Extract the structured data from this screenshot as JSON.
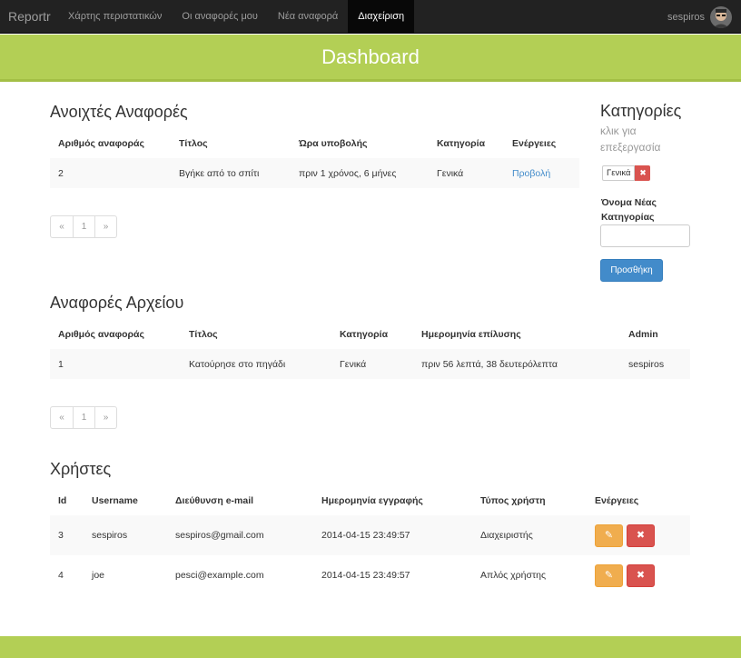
{
  "navbar": {
    "brand": "Reportr",
    "items": [
      {
        "label": "Χάρτης περιστατικών"
      },
      {
        "label": "Οι αναφορές μου"
      },
      {
        "label": "Νέα αναφορά"
      },
      {
        "label": "Διαχείριση"
      }
    ],
    "active_index": 3,
    "username": "sespiros"
  },
  "banner": {
    "title": "Dashboard"
  },
  "open_reports": {
    "heading": "Ανοιχτές Αναφορές",
    "columns": [
      "Αριθμός αναφοράς",
      "Τίτλος",
      "Ώρα υποβολής",
      "Κατηγορία",
      "Ενέργειες"
    ],
    "rows": [
      {
        "id": "2",
        "title": "Βγήκε από το σπίτι",
        "submitted": "πριν 1 χρόνος, 6 μήνες",
        "category": "Γενικά",
        "action": "Προβολή"
      }
    ],
    "pager": {
      "prev": "«",
      "page": "1",
      "next": "»"
    }
  },
  "categories": {
    "heading": "Κατηγορίες",
    "hint": "κλικ για επεξεργασία",
    "items": [
      "Γενικά"
    ],
    "new_label": "Όνομα Νέας Κατηγορίας",
    "new_value": "",
    "add_button": "Προσθήκη"
  },
  "archive_reports": {
    "heading": "Αναφορές Αρχείου",
    "columns": [
      "Αριθμός αναφοράς",
      "Τίτλος",
      "Κατηγορία",
      "Ημερομηνία επίλυσης",
      "Admin"
    ],
    "rows": [
      {
        "id": "1",
        "title": "Κατούρησε στο πηγάδι",
        "category": "Γενικά",
        "resolved": "πριν 56 λεπτά, 38 δευτερόλεπτα",
        "admin": "sespiros"
      }
    ],
    "pager": {
      "prev": "«",
      "page": "1",
      "next": "»"
    }
  },
  "users": {
    "heading": "Χρήστες",
    "columns": [
      "Id",
      "Username",
      "Διεύθυνση e-mail",
      "Ημερομηνία εγγραφής",
      "Τύπος χρήστη",
      "Ενέργειες"
    ],
    "rows": [
      {
        "id": "3",
        "username": "sespiros",
        "email": "sespiros@gmail.com",
        "registered": "2014-04-15 23:49:57",
        "type": "Διαχειριστής"
      },
      {
        "id": "4",
        "username": "joe",
        "email": "pesci@example.com",
        "registered": "2014-04-15 23:49:57",
        "type": "Απλός χρήστης"
      }
    ]
  },
  "colors": {
    "accent": "#b3cf55",
    "primary": "#428bca",
    "danger": "#d9534f",
    "warning": "#f0ad4e",
    "navbar": "#222222"
  },
  "icons": {
    "edit": "pencil-icon",
    "delete": "remove-icon"
  }
}
